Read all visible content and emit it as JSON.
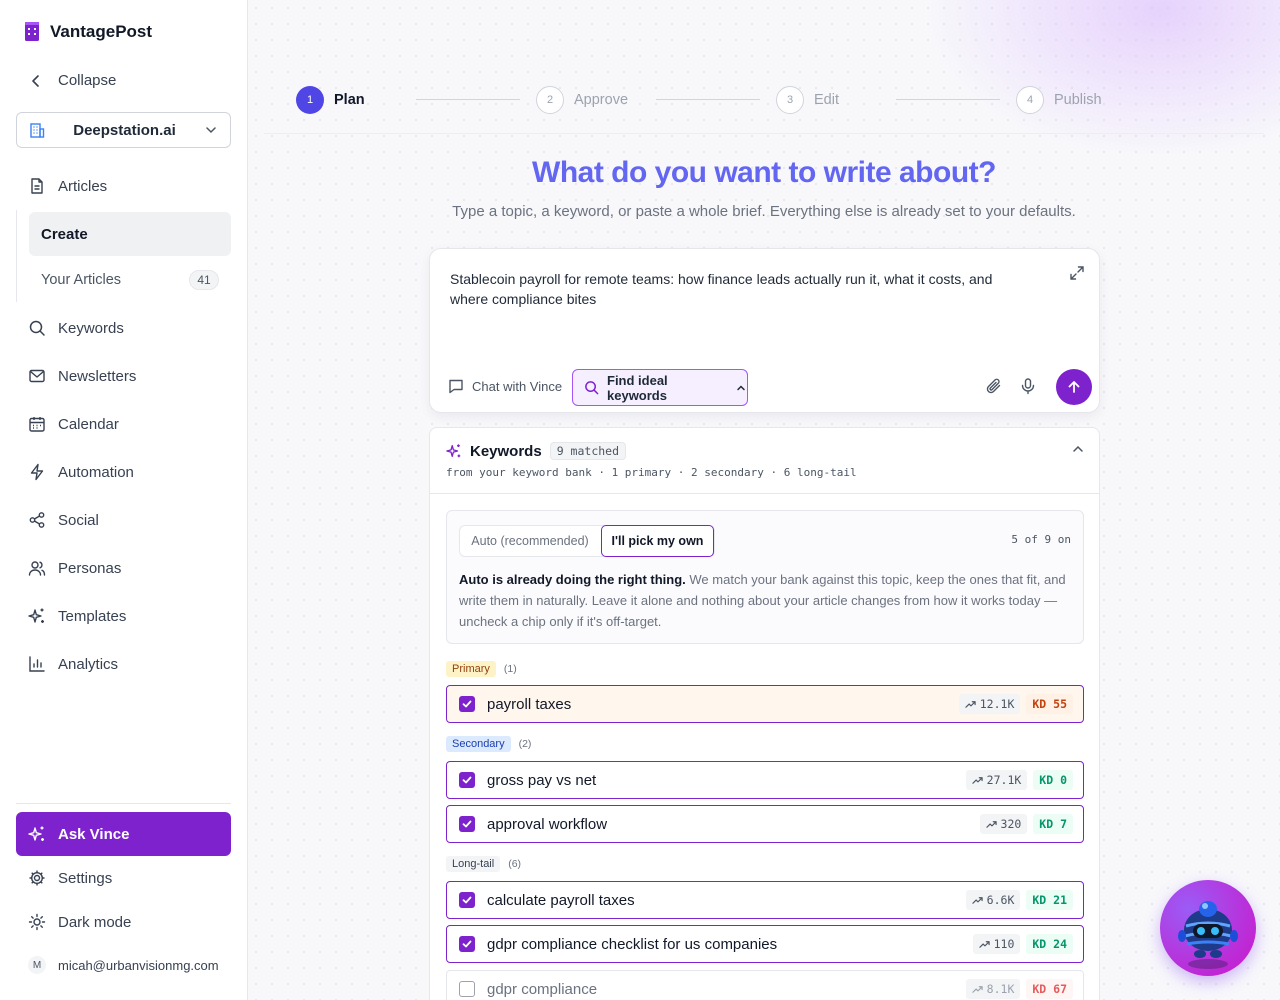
{
  "app": {
    "brand": "VantagePost"
  },
  "sidebar": {
    "collapse_label": "Collapse",
    "workspace": "Deepstation.ai",
    "items": [
      {
        "label": "Articles",
        "icon": "file-text-icon"
      },
      {
        "label": "Keywords",
        "icon": "search-icon"
      },
      {
        "label": "Newsletters",
        "icon": "mail-icon"
      },
      {
        "label": "Calendar",
        "icon": "calendar-icon"
      },
      {
        "label": "Automation",
        "icon": "zap-icon"
      },
      {
        "label": "Social",
        "icon": "share-icon"
      },
      {
        "label": "Personas",
        "icon": "users-icon"
      },
      {
        "label": "Templates",
        "icon": "sparkles-icon"
      },
      {
        "label": "Analytics",
        "icon": "bar-chart-icon"
      }
    ],
    "subitems": {
      "create": "Create",
      "your_articles": "Your Articles",
      "your_articles_count": "41"
    },
    "ask_label": "Ask Vince",
    "settings_label": "Settings",
    "dark_mode_label": "Dark mode",
    "user_initial": "M",
    "user_email": "micah@urbanvisionmg.com"
  },
  "stepper": {
    "steps": [
      {
        "num": "1",
        "label": "Plan",
        "active": true
      },
      {
        "num": "2",
        "label": "Approve",
        "active": false
      },
      {
        "num": "3",
        "label": "Edit",
        "active": false
      },
      {
        "num": "4",
        "label": "Publish",
        "active": false
      }
    ]
  },
  "hero": {
    "headline": "What do you want to write about?",
    "subtitle": "Type a topic, a keyword, or paste a whole brief. Everything else is already set to your defaults."
  },
  "composer": {
    "text": "Stablecoin payroll for remote teams: how finance leads actually run it, what it costs, and where compliance bites",
    "chat_label": "Chat with Vince",
    "find_label": "Find ideal keywords"
  },
  "keywords": {
    "title": "Keywords",
    "matched": "9 matched",
    "meta": "from your keyword bank · 1 primary · 2 secondary · 6 long-tail",
    "mode_auto": "Auto (recommended)",
    "mode_own": "I'll pick my own",
    "on_count": "5 of 9 on",
    "desc_bold": "Auto is already doing the right thing.",
    "desc_rest": " We match your bank against this topic, keep the ones that fit, and write them in naturally. Leave it alone and nothing about your article changes from how it works today — uncheck a chip only if it's off-target.",
    "groups": {
      "primary": {
        "label": "Primary",
        "count": "(1)"
      },
      "secondary": {
        "label": "Secondary",
        "count": "(2)"
      },
      "longtail": {
        "label": "Long-tail",
        "count": "(6)"
      }
    },
    "rows": [
      {
        "label": "payroll taxes",
        "volume": "12.1K",
        "kd": "KD 55",
        "checked": true
      },
      {
        "label": "gross pay vs net",
        "volume": "27.1K",
        "kd": "KD 0",
        "checked": true
      },
      {
        "label": "approval workflow",
        "volume": "320",
        "kd": "KD 7",
        "checked": true
      },
      {
        "label": "calculate payroll taxes",
        "volume": "6.6K",
        "kd": "KD 21",
        "checked": true
      },
      {
        "label": "gdpr compliance checklist for us companies",
        "volume": "110",
        "kd": "KD 24",
        "checked": true
      },
      {
        "label": "gdpr compliance",
        "volume": "8.1K",
        "kd": "KD 67",
        "checked": false
      }
    ]
  },
  "colors": {
    "accent": "#7e22ce",
    "headline": "#6366f1",
    "step_active": "#4f46e5"
  }
}
